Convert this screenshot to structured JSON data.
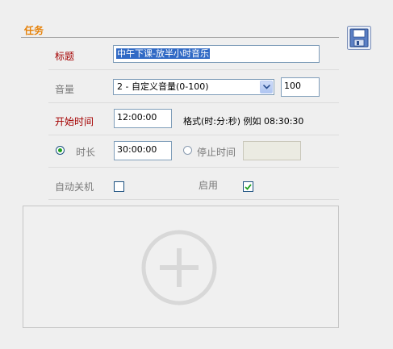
{
  "section": {
    "title": "任务"
  },
  "form": {
    "title_label": "标题",
    "title_value": "中午下课-放半小时音乐",
    "volume_label": "音量",
    "volume_select": "2 - 自定义音量(0-100)",
    "volume_value": "100",
    "start_label": "开始时间",
    "start_value": "12:00:00",
    "format_hint": "格式(时:分:秒) 例如 08:30:30",
    "duration_label": "时长",
    "duration_value": "30:00:00",
    "duration_selected": true,
    "stop_label": "停止时间",
    "stop_value": "",
    "autoshutdown_label": "自动关机",
    "autoshutdown_checked": false,
    "enable_label": "启用",
    "enable_checked": true
  },
  "icons": {
    "save": "save-icon",
    "add": "plus-icon",
    "dropdown": "chevron-down-icon"
  },
  "colors": {
    "section_title": "#e6820a",
    "required_label": "#a40000",
    "selection": "#316ac5",
    "radio_dot": "#21a121",
    "check": "#21a121"
  }
}
